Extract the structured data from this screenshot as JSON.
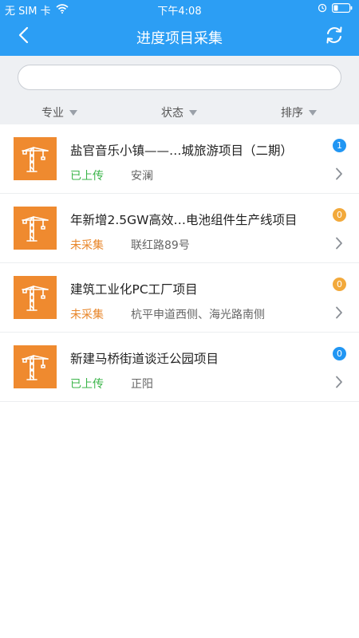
{
  "status_bar": {
    "carrier": "无 SIM 卡",
    "time": "下午4:08"
  },
  "nav": {
    "title": "进度项目采集",
    "back_icon": "chevron-left-icon",
    "refresh_icon": "refresh-icon"
  },
  "search": {
    "value": "",
    "placeholder": ""
  },
  "filters": [
    {
      "label": "专业"
    },
    {
      "label": "状态"
    },
    {
      "label": "排序"
    }
  ],
  "colors": {
    "header": "#2c9ef4",
    "thumb": "#ef8a2f",
    "uploaded": "#3bb54a",
    "not_collected": "#e8862a",
    "badge_blue": "#2196f3",
    "badge_orange": "#f2a93b"
  },
  "items": [
    {
      "title": "盐官音乐小镇——…城旅游项目（二期）",
      "status": "已上传",
      "location": "安澜",
      "badge": "1"
    },
    {
      "title": "年新增2.5GW高效…电池组件生产线项目",
      "status": "未采集",
      "location": "联红路89号",
      "badge": "0"
    },
    {
      "title": "建筑工业化PC工厂项目",
      "status": "未采集",
      "location": "杭平申道西侧、海光路南侧",
      "badge": "0"
    },
    {
      "title": "新建马桥街道谈迁公园项目",
      "status": "已上传",
      "location": "正阳",
      "badge": "0"
    }
  ]
}
